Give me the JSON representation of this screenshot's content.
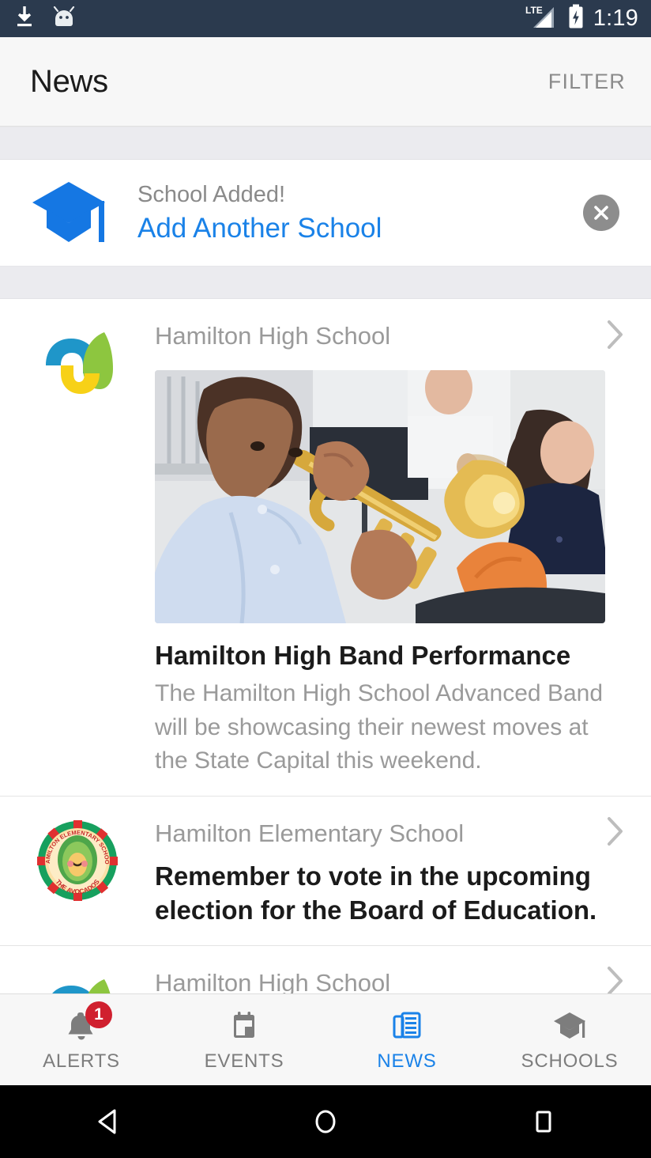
{
  "statusbar": {
    "time": "1:19",
    "network_label": "LTE",
    "icons": [
      "download-icon",
      "android-head-icon",
      "lte-signal-icon",
      "battery-charging-icon"
    ]
  },
  "appbar": {
    "title": "News",
    "filter_label": "FILTER"
  },
  "promo": {
    "sub_label": "School Added!",
    "link_label": "Add Another School",
    "icon": "graduation-cap-icon",
    "close_icon": "close-circle-icon"
  },
  "feed": [
    {
      "school": "Hamilton High School",
      "logo": "hamilton-high-logo",
      "title": "Hamilton High Band Performance",
      "description": "The Hamilton High School Advanced Band will be showcasing their newest moves at the State Capital this weekend.",
      "has_photo": true,
      "photo_alt": "student playing trumpet in band class"
    },
    {
      "school": "Hamilton Elementary School",
      "logo": "hamilton-elementary-avocado-logo",
      "headline": "Remember to vote in the upcoming election for the Board of Education.",
      "has_photo": false
    },
    {
      "school": "Hamilton High School",
      "logo": "hamilton-high-logo",
      "has_photo": false
    }
  ],
  "tabs": [
    {
      "label": "ALERTS",
      "icon": "bell-icon",
      "badge": "1",
      "active": false
    },
    {
      "label": "EVENTS",
      "icon": "calendar-icon",
      "badge": "",
      "active": false
    },
    {
      "label": "NEWS",
      "icon": "newspaper-icon",
      "badge": "",
      "active": true
    },
    {
      "label": "SCHOOLS",
      "icon": "graduation-cap-icon",
      "badge": "",
      "active": false
    }
  ],
  "navbar": {
    "back": "back-triangle-icon",
    "home": "home-circle-icon",
    "recents": "recents-square-icon"
  },
  "colors": {
    "status_bar": "#2b3a4e",
    "accent_blue": "#1a82e8",
    "badge_red": "#d0202f",
    "muted_text": "#9a9a9a",
    "spacer_gray": "#ebebef"
  }
}
